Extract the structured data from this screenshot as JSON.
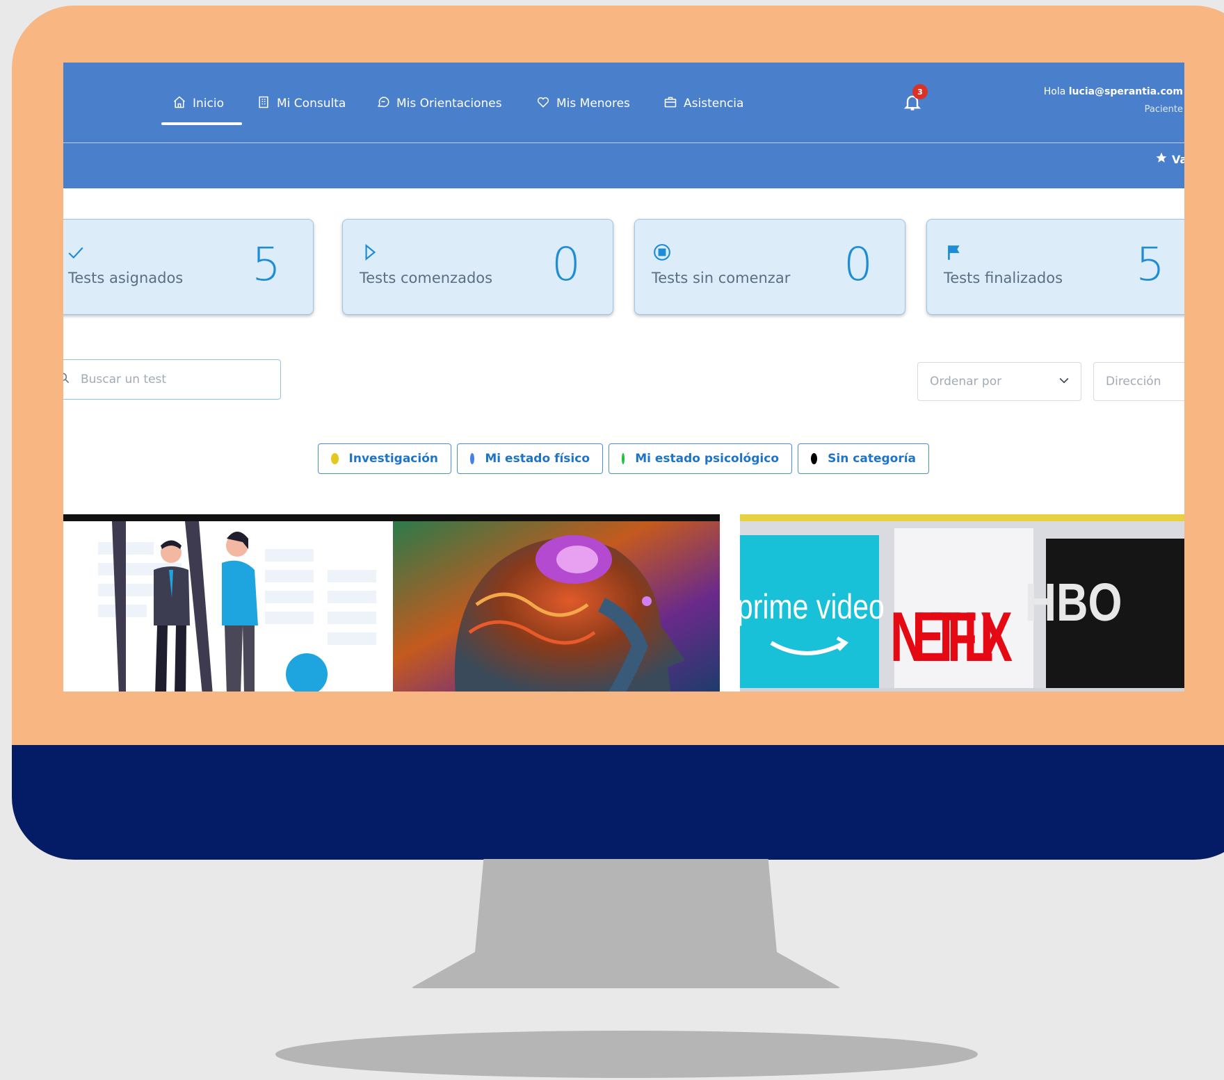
{
  "nav": {
    "items": [
      {
        "label": "Inicio",
        "icon": "home-icon"
      },
      {
        "label": "Mi Consulta",
        "icon": "building-icon"
      },
      {
        "label": "Mis Orientaciones",
        "icon": "chat-icon"
      },
      {
        "label": "Mis Menores",
        "icon": "heart-icon"
      },
      {
        "label": "Asistencia",
        "icon": "briefcase-icon"
      }
    ],
    "notifications_count": "3",
    "user": {
      "greeting": "Hola",
      "email": "lucia@sperantia.com",
      "role": "Paciente"
    },
    "subbar_action": "Va"
  },
  "stats": [
    {
      "label": "Tests asignados",
      "value": "5",
      "icon": "check-icon"
    },
    {
      "label": "Tests comenzados",
      "value": "0",
      "icon": "play-outline-icon"
    },
    {
      "label": "Tests sin comenzar",
      "value": "0",
      "icon": "stop-circle-icon"
    },
    {
      "label": "Tests finalizados",
      "value": "5",
      "icon": "flag-icon"
    }
  ],
  "search": {
    "placeholder": "Buscar un test"
  },
  "sort": {
    "order_placeholder": "Ordenar por",
    "direction_placeholder": "Dirección"
  },
  "categories": [
    {
      "label": "Investigación",
      "color": "#e3c91f"
    },
    {
      "label": "Mi estado físico",
      "color": "#4680e6"
    },
    {
      "label": "Mi estado psicológico",
      "color": "#1fc13a"
    },
    {
      "label": "Sin categoría",
      "color": "#000000"
    }
  ],
  "cards": [
    {
      "image": "people-mirror-illustration"
    },
    {
      "image": "psychedelic-brain-head-image"
    },
    {
      "image": "streaming-logos-image",
      "logos": [
        "prime video",
        "NETFLIX",
        "HBO"
      ]
    }
  ],
  "colors": {
    "header": "#4a7fcb",
    "frame": "#f8b682",
    "chin": "#041c66",
    "accent": "#1e8dd6"
  }
}
